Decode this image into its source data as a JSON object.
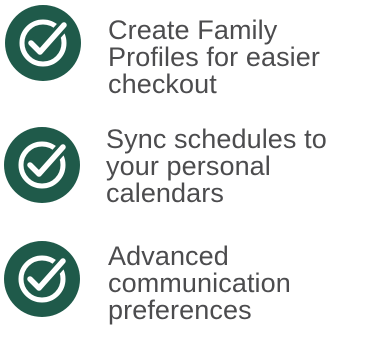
{
  "colors": {
    "icon_background": "#1f5a4a",
    "icon_foreground": "#ffffff",
    "text": "#4c4c4e"
  },
  "features": [
    {
      "icon": "check-circle-icon",
      "lines": [
        "Create Family",
        "Profiles for easier",
        "checkout"
      ]
    },
    {
      "icon": "check-circle-icon",
      "lines": [
        "Sync schedules to",
        "your personal",
        "calendars"
      ]
    },
    {
      "icon": "check-circle-icon",
      "lines": [
        "Advanced",
        "communication",
        "preferences"
      ]
    }
  ]
}
